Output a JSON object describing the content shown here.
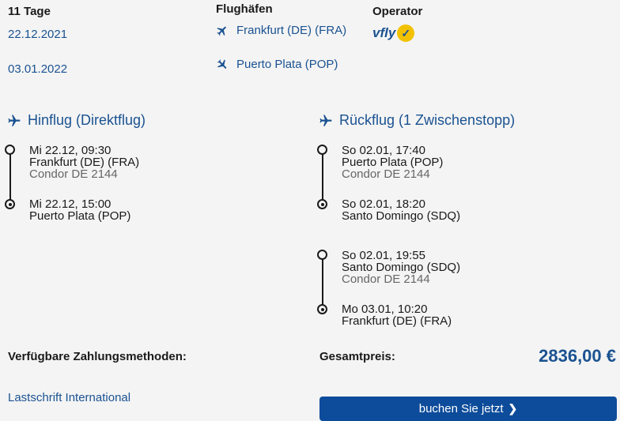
{
  "trip": {
    "duration": "11 Tage",
    "outbound_date": "22.12.2021",
    "return_date": "03.01.2022"
  },
  "airports": {
    "header": "Flughäfen",
    "departure": "Frankfurt (DE) (FRA)",
    "arrival": "Puerto Plata (POP)"
  },
  "operator": {
    "header": "Operator",
    "logo_text": "vfly",
    "badge": "✓"
  },
  "outbound": {
    "title": "Hinflug (Direktflug)",
    "stops": [
      {
        "time": "Mi 22.12, 09:30",
        "place": "Frankfurt (DE) (FRA)",
        "carrier": "Condor DE 2144"
      },
      {
        "time": "Mi 22.12, 15:00",
        "place": "Puerto Plata (POP)"
      }
    ]
  },
  "return": {
    "title": "Rückflug (1 Zwischenstopp)",
    "stops": [
      {
        "time": "So 02.01, 17:40",
        "place": "Puerto Plata (POP)",
        "carrier": "Condor DE 2144"
      },
      {
        "time": "So 02.01, 18:20",
        "place": "Santo Domingo (SDQ)"
      },
      {
        "time": "So 02.01, 19:55",
        "place": "Santo Domingo (SDQ)",
        "carrier": "Condor DE 2144"
      },
      {
        "time": "Mo 03.01, 10:20",
        "place": "Frankfurt (DE) (FRA)"
      }
    ]
  },
  "payment": {
    "label": "Verfügbare Zahlungsmethoden:",
    "method": "Lastschrift International"
  },
  "total": {
    "label": "Gesamtpreis:",
    "price": "2836,00 €"
  },
  "book_button": {
    "label": "buchen Sie jetzt",
    "chevron": "❯"
  },
  "colors": {
    "accent": "#1a5291",
    "button": "#0d4c9a",
    "background": "#f4f4f4",
    "badge": "#f2c200"
  }
}
